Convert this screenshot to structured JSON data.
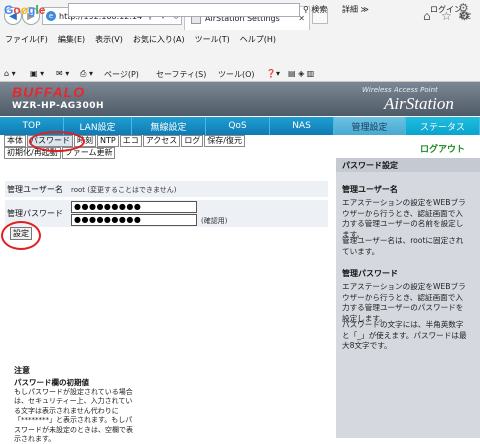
{
  "browser": {
    "address": "http://192.168.12.14/cgi-bin/",
    "tab_title": "AirStation Settings",
    "menu": [
      "ファイル(F)",
      "編集(E)",
      "表示(V)",
      "お気に入り(A)",
      "ツール(T)",
      "ヘルプ(H)"
    ],
    "google_logo": "Google",
    "google_search_label": "検索",
    "google_more_label": "詳細 ≫",
    "google_login_label": "ログイン",
    "google_settings_label": "設定",
    "cmd": {
      "page": "ページ(P)",
      "safety": "セーフティ(S)",
      "tools": "ツール(O)"
    }
  },
  "header": {
    "brand": "BUFFALO",
    "model": "WZR-HP-AG300H",
    "product_label": "Wireless Access Point",
    "product_logo": "AirStation"
  },
  "main_tabs": [
    "TOP",
    "LAN設定",
    "無線設定",
    "QoS",
    "NAS",
    "管理設定",
    "ステータス"
  ],
  "active_main_tab": "管理設定",
  "sub_tabs_row1": [
    "本体",
    "パスワード",
    "時刻",
    "NTP",
    "エコ",
    "アクセス",
    "ログ",
    "保存/復元"
  ],
  "sub_tabs_row2": [
    "初期化/再起動",
    "ファーム更新"
  ],
  "logout_label": "ログアウト",
  "form": {
    "admin_user_label": "管理ユーザー名",
    "admin_user_value": "root (変更することはできません)",
    "admin_password_label": "管理パスワード",
    "password_value": "●●●●●●●●●",
    "password_confirm_value": "●●●●●●●●●",
    "confirm_note": "(確認用)",
    "submit_label": "設定"
  },
  "help": {
    "title": "パスワード設定",
    "section1_title": "管理ユーザー名",
    "section1_text": "エアステーションの設定をWEBブラウザーから行うとき、認証画面で入力する管理ユーザーの名前を設定します。",
    "section1_text2": "管理ユーザー名は、rootに固定されています。",
    "section2_title": "管理パスワード",
    "section2_text": "エアステーションの設定をWEBブラウザーから行うとき、認証画面で入力する管理ユーザーのパスワードを設定します。",
    "section2_text2": "パスワードの文字には、半角英数字と「_」が使えます。パスワードは最大8文字です。",
    "note_title": "注意",
    "note_subtitle": "パスワード欄の初期値",
    "note_text": "もしパスワードが設定されている場合は、セキュリティー上、入力されている文字は表示されません代わりに「********」と表示されます。もしパスワードが未設定のときは、空欄で表示されます。"
  },
  "colors": {
    "tab_bar": "#1489c4",
    "active_tab": "#5bb6dc",
    "brand_red": "#e9262b",
    "logout_green": "#1b8a24",
    "annotation_red": "#e02020"
  }
}
